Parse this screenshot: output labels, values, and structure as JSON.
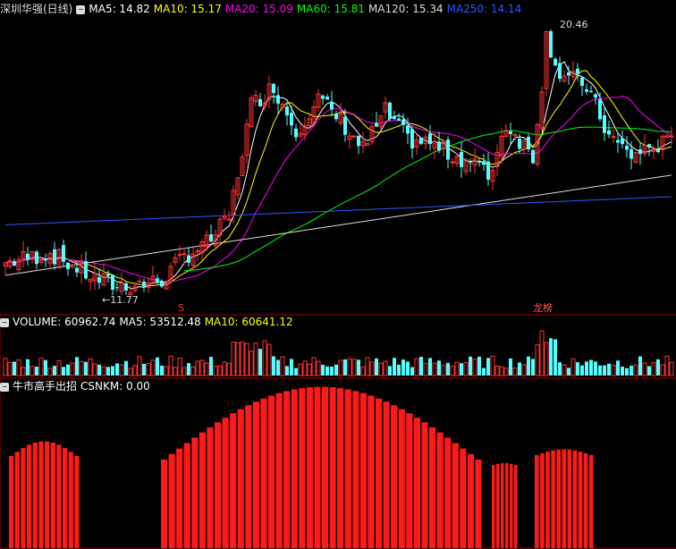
{
  "header": {
    "stock_name": "深圳华强(日线)",
    "ma": [
      {
        "label": "MA5: 14.82",
        "color": "#ffffff"
      },
      {
        "label": "MA10: 15.17",
        "color": "#ffff00"
      },
      {
        "label": "MA20: 15.09",
        "color": "#ff00ff"
      },
      {
        "label": "MA60: 15.81",
        "color": "#00ff00"
      },
      {
        "label": "MA120: 15.34",
        "color": "#dddddd"
      },
      {
        "label": "MA250: 14.14",
        "color": "#3355ff"
      }
    ]
  },
  "annotations": {
    "high_label": "20.46",
    "low_label": "11.77",
    "s_marker": "S",
    "dragon_marker": "龙榜"
  },
  "volume": {
    "labels": [
      {
        "text": "VOLUME: 60962.74",
        "color": "#ffffff"
      },
      {
        "text": "MA5: 53512.48",
        "color": "#ffffff"
      },
      {
        "text": "MA10: 60641.12",
        "color": "#ffff00"
      }
    ]
  },
  "indicator": {
    "labels": [
      {
        "text": "牛市高手出招",
        "color": "#ffffff"
      },
      {
        "text": "CSNKM: 0.00",
        "color": "#ffffff"
      }
    ]
  },
  "colors": {
    "up": "#ff3232",
    "down": "#54ffff",
    "grid": "#990000",
    "indicator": "#ff1a1a"
  },
  "chart_data": {
    "type": "candlestick",
    "high": 20.46,
    "low": 11.77,
    "series": [
      {
        "name": "MA5",
        "value": 14.82
      },
      {
        "name": "MA10",
        "value": 15.17
      },
      {
        "name": "MA20",
        "value": 15.09
      },
      {
        "name": "MA60",
        "value": 15.81
      },
      {
        "name": "MA120",
        "value": 15.34
      },
      {
        "name": "MA250",
        "value": 14.14
      }
    ],
    "volume": {
      "VOLUME": 60962.74,
      "MA5": 53512.48,
      "MA10": 60641.12
    },
    "indicator": {
      "CSNKM": 0.0
    }
  }
}
